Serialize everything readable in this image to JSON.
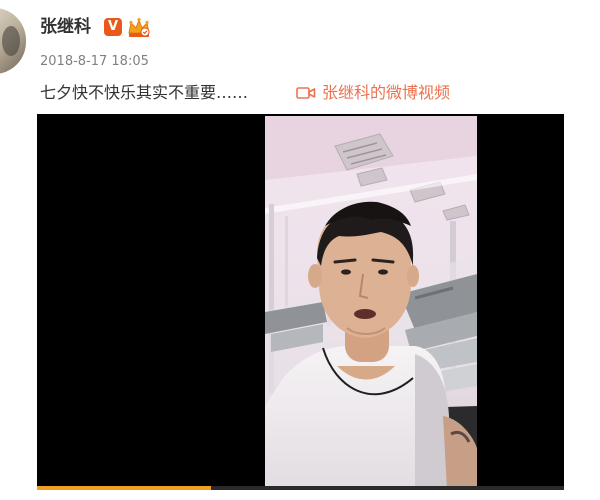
{
  "post": {
    "author": "张继科",
    "verified_badge": "V",
    "timestamp": "2018-8-17 18:05",
    "text": "七夕快不快乐其实不重要……",
    "video_link": "张继科的微博视频",
    "link_color": "#eb7350",
    "badge_color": "#e8591a"
  },
  "icons": {
    "verified": "verified-v-icon",
    "member": "crown-member-icon",
    "video": "video-camera-icon"
  },
  "video": {
    "progress": 0.33,
    "progress_color": "#f0a020"
  }
}
